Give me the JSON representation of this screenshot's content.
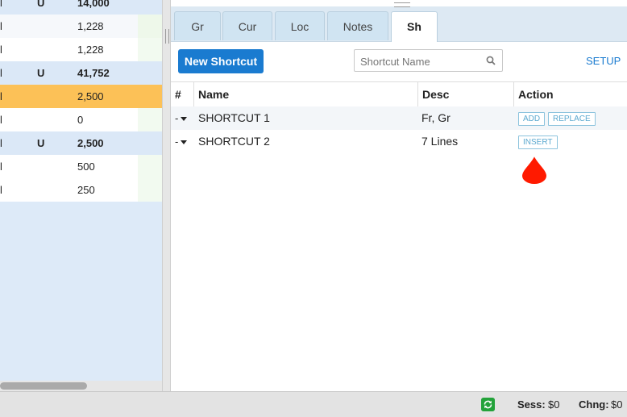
{
  "left_grid": {
    "rows": [
      {
        "c1": "l",
        "c2": "U",
        "c3": "14,000",
        "style": "blue"
      },
      {
        "c1": "l",
        "c2": "",
        "c3": "1,228",
        "style": "lightwhite"
      },
      {
        "c1": "l",
        "c2": "",
        "c3": "1,228",
        "style": "white"
      },
      {
        "c1": "l",
        "c2": "U",
        "c3": "41,752",
        "style": "blue"
      },
      {
        "c1": "l",
        "c2": "",
        "c3": "2,500",
        "style": "orange"
      },
      {
        "c1": "l",
        "c2": "",
        "c3": "0",
        "style": "white"
      },
      {
        "c1": "l",
        "c2": "U",
        "c3": "2,500",
        "style": "blue"
      },
      {
        "c1": "l",
        "c2": "",
        "c3": "500",
        "style": "white"
      },
      {
        "c1": "l",
        "c2": "",
        "c3": "250",
        "style": "white"
      }
    ]
  },
  "tabs": [
    {
      "label": "Gr"
    },
    {
      "label": "Cur"
    },
    {
      "label": "Loc"
    },
    {
      "label": "Notes"
    },
    {
      "label": "Sh",
      "active": true
    }
  ],
  "toolbar": {
    "new_shortcut_label": "New Shortcut",
    "search_placeholder": "Shortcut Name",
    "setup_label": "SETUP"
  },
  "grid": {
    "headers": {
      "num": "#",
      "name": "Name",
      "desc": "Desc",
      "action": "Action"
    },
    "rows": [
      {
        "dd": "-",
        "name": "SHORTCUT 1",
        "desc": "Fr, Gr",
        "actions": [
          "ADD",
          "REPLACE"
        ]
      },
      {
        "dd": "-",
        "name": "SHORTCUT 2",
        "desc": "7 Lines",
        "actions": [
          "INSERT"
        ]
      }
    ]
  },
  "status": {
    "sess_label": "Sess:",
    "sess_value": "$0",
    "chng_label": "Chng:",
    "chng_value": "$0"
  },
  "colors": {
    "accent": "#1a7bd0",
    "highlight_row": "#fcc157",
    "drop_marker": "#ff1a00",
    "refresh": "#23a23a"
  },
  "icons": {
    "search": "search-icon",
    "refresh": "refresh-icon",
    "marker": "drop-marker-icon"
  }
}
